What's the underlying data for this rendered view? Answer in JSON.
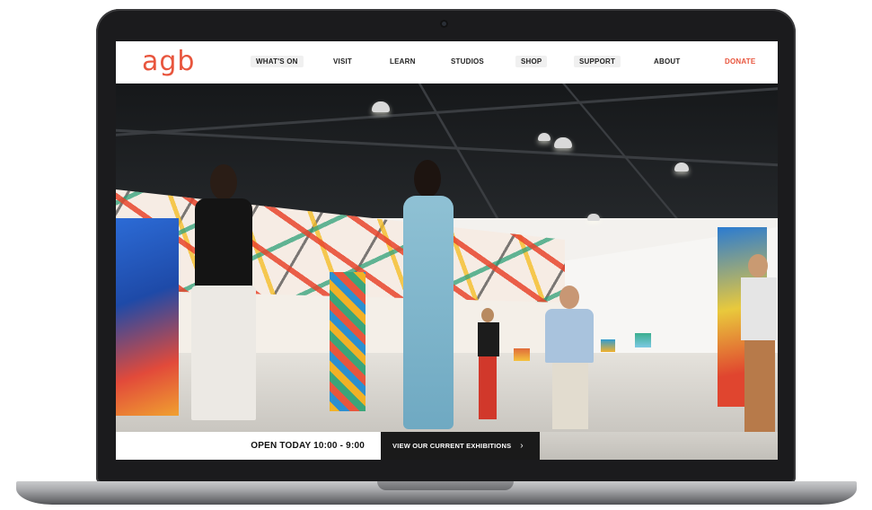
{
  "brand": {
    "logo_text": "agb",
    "accent_color": "#e8553d"
  },
  "nav": {
    "items": [
      {
        "label": "WHAT'S ON"
      },
      {
        "label": "VISIT"
      },
      {
        "label": "LEARN"
      },
      {
        "label": "STUDIOS"
      },
      {
        "label": "SHOP"
      },
      {
        "label": "SUPPORT"
      },
      {
        "label": "ABOUT"
      }
    ],
    "donate_label": "DONATE"
  },
  "hero": {
    "image_icon": "gallery-photo",
    "hours_text": "OPEN TODAY 10:00 - 9:00",
    "cta_label": "VIEW OUR CURRENT EXHIBITIONS",
    "cta_icon": "chevron-right-icon"
  }
}
